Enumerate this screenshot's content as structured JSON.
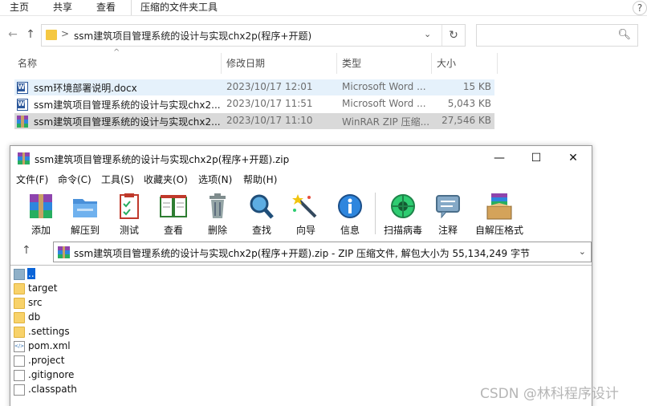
{
  "explorer": {
    "ribbon_tabs": [
      "主页",
      "共享",
      "查看",
      "压缩的文件夹工具"
    ],
    "help_label": "?",
    "address": {
      "path": "ssm建筑项目管理系统的设计与实现chx2p(程序+开题)",
      "separator": ">"
    },
    "search_placeholder": "",
    "columns": {
      "name": "名称",
      "date": "修改日期",
      "type": "类型",
      "size": "大小"
    },
    "files": [
      {
        "name": "ssm环境部署说明.docx",
        "date": "2023/10/17 12:01",
        "type": "Microsoft Word ...",
        "size": "15 KB",
        "icon": "word-doc-icon"
      },
      {
        "name": "ssm建筑项目管理系统的设计与实现chx2...",
        "date": "2023/10/17 11:51",
        "type": "Microsoft Word ...",
        "size": "5,043 KB",
        "icon": "word-doc-icon"
      },
      {
        "name": "ssm建筑项目管理系统的设计与实现chx2...",
        "date": "2023/10/17 11:10",
        "type": "WinRAR ZIP 压缩...",
        "size": "27,546 KB",
        "icon": "winrar-archive-icon"
      }
    ]
  },
  "winrar": {
    "title": "ssm建筑项目管理系统的设计与实现chx2p(程序+开题).zip",
    "window_buttons": {
      "minimize": "—",
      "maximize": "☐",
      "close": "✕"
    },
    "menu": [
      "文件(F)",
      "命令(C)",
      "工具(S)",
      "收藏夹(O)",
      "选项(N)",
      "帮助(H)"
    ],
    "toolbar": [
      "添加",
      "解压到",
      "测试",
      "查看",
      "删除",
      "查找",
      "向导",
      "信息",
      "扫描病毒",
      "注释",
      "自解压格式"
    ],
    "path_text": "ssm建筑项目管理系统的设计与实现chx2p(程序+开题).zip - ZIP 压缩文件, 解包大小为 55,134,249 字节",
    "items": [
      {
        "name": "..",
        "kind": "updir"
      },
      {
        "name": "target",
        "kind": "folder"
      },
      {
        "name": "src",
        "kind": "folder"
      },
      {
        "name": "db",
        "kind": "folder"
      },
      {
        "name": ".settings",
        "kind": "folder"
      },
      {
        "name": "pom.xml",
        "kind": "xml"
      },
      {
        "name": ".project",
        "kind": "file"
      },
      {
        "name": ".gitignore",
        "kind": "file"
      },
      {
        "name": ".classpath",
        "kind": "file"
      }
    ]
  },
  "watermark": "CSDN @林科程序设计",
  "colors": {
    "selection": "#cce8ff",
    "hover": "#e5f1fb",
    "inactive_selection": "#d9d9d9",
    "rar_selection": "#0a64d8",
    "folder": "#f8d26a"
  }
}
